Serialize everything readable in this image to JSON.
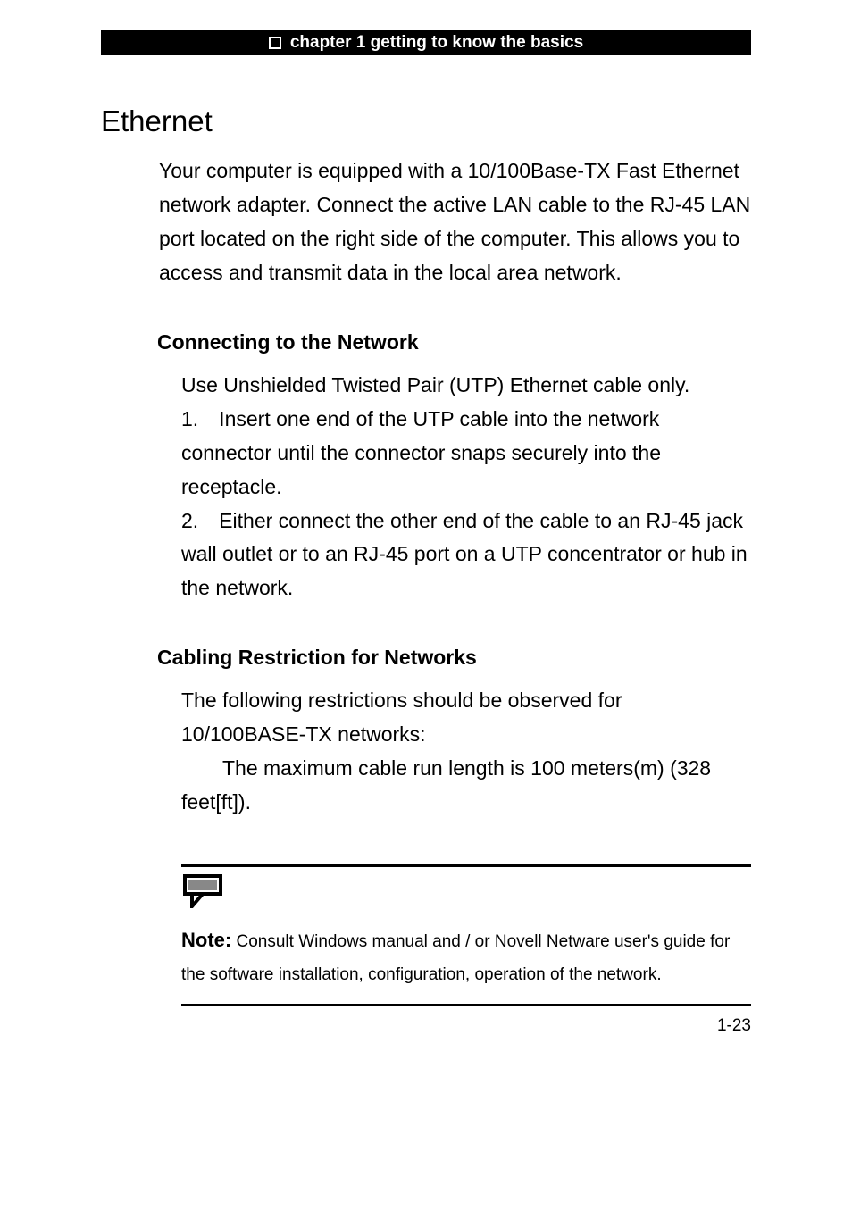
{
  "chapter_header": "chapter 1 getting to know the basics",
  "section_title": "Ethernet",
  "intro_text": "Your computer is equipped with a 10/100Base-TX Fast Ethernet network adapter. Connect the active LAN cable to the RJ-45 LAN port located on the right side of the computer. This allows you to access and transmit data in the local area network.",
  "connecting": {
    "title": "Connecting to the Network",
    "body": "Use Unshielded Twisted Pair (UTP) Ethernet cable only.\n1. Insert one end of the UTP cable into the network connector until the connector snaps securely into the receptacle.\n2. Either connect the other end of the cable to an RJ-45 jack wall outlet or to an RJ-45 port on a UTP concentrator or hub in the network."
  },
  "cabling": {
    "title": "Cabling Restriction for Networks",
    "body": "The following restrictions should be observed for 10/100BASE-TX networks:\n  The maximum cable run length is 100 meters(m) (328 feet[ft])."
  },
  "note": {
    "label": "Note:",
    "text": " Consult Windows manual and / or Novell Netware user's guide for the software installation, configuration, operation of the network."
  },
  "page_number": "1-23"
}
